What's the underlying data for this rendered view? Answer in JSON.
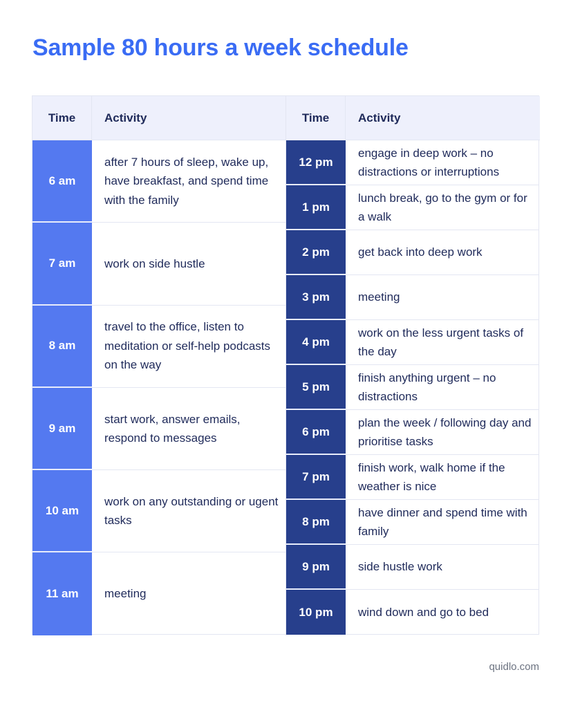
{
  "title": "Sample 80 hours a week schedule",
  "table": {
    "headers": {
      "time": "Time",
      "activity": "Activity"
    },
    "morning": [
      {
        "time": "6 am",
        "activity": "after 7 hours of sleep, wake up, have breakfast, and spend time with the family"
      },
      {
        "time": "7 am",
        "activity": "work on side hustle"
      },
      {
        "time": "8 am",
        "activity": "travel to the office, listen to meditation or self-help podcasts on the way"
      },
      {
        "time": "9 am",
        "activity": "start work, answer emails, respond to messages"
      },
      {
        "time": "10 am",
        "activity": "work on any outstanding or ugent tasks"
      },
      {
        "time": "11 am",
        "activity": "meeting"
      }
    ],
    "afternoon": [
      {
        "time": "12 pm",
        "activity": "engage in deep work – no distractions or interruptions"
      },
      {
        "time": "1 pm",
        "activity": "lunch break, go to the gym or for a walk"
      },
      {
        "time": "2 pm",
        "activity": "get back into deep work"
      },
      {
        "time": "3 pm",
        "activity": "meeting"
      },
      {
        "time": "4 pm",
        "activity": "work on the less urgent tasks of the day"
      },
      {
        "time": "5 pm",
        "activity": "finish anything urgent – no distractions"
      },
      {
        "time": "6 pm",
        "activity": "plan the week / following day and prioritise tasks"
      },
      {
        "time": "7 pm",
        "activity": "finish work, walk home if the weather is nice"
      },
      {
        "time": "8 pm",
        "activity": "have dinner and spend time with family"
      },
      {
        "time": "9 pm",
        "activity": "side hustle work"
      },
      {
        "time": "10 pm",
        "activity": "wind down and go to bed"
      }
    ]
  },
  "colors": {
    "title": "#3a6cf4",
    "morning_time": "#5479f0",
    "afternoon_time": "#273f8c",
    "header_bg": "#eef0fc"
  },
  "footer": "quidlo.com"
}
